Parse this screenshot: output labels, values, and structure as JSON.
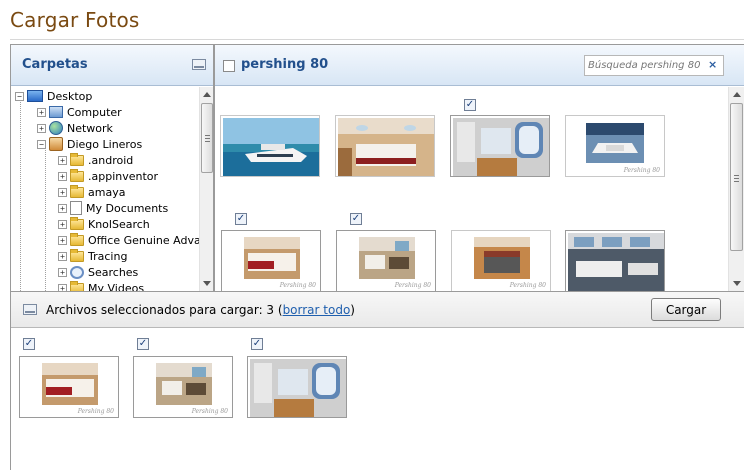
{
  "page": {
    "title": "Cargar Fotos"
  },
  "folders": {
    "title": "Carpetas",
    "items": [
      {
        "label": "Desktop",
        "icon": "desktop-icon"
      },
      {
        "label": "Computer",
        "icon": "computer-icon"
      },
      {
        "label": "Network",
        "icon": "network-icon"
      },
      {
        "label": "Diego Lineros",
        "icon": "user-folder-icon"
      },
      {
        "label": ".android",
        "icon": "folder-icon"
      },
      {
        "label": ".appinventor",
        "icon": "folder-icon"
      },
      {
        "label": "amaya",
        "icon": "folder-icon"
      },
      {
        "label": "My Documents",
        "icon": "documents-icon"
      },
      {
        "label": "KnolSearch",
        "icon": "folder-icon"
      },
      {
        "label": "Office Genuine Advan",
        "icon": "folder-icon"
      },
      {
        "label": "Tracing",
        "icon": "folder-icon"
      },
      {
        "label": "Searches",
        "icon": "search-folder-icon"
      },
      {
        "label": "My Videos",
        "icon": "folder-icon"
      }
    ]
  },
  "album": {
    "title": "pershing 80",
    "search_placeholder": "Búsqueda pershing 80",
    "clear_symbol": "×",
    "photo_caption": "Pershing 80",
    "photos": [
      {
        "kind": "exterior",
        "checked": false
      },
      {
        "kind": "cabin",
        "checked": false
      },
      {
        "kind": "bathroom",
        "checked": true
      },
      {
        "kind": "deck",
        "checked": false
      },
      {
        "kind": "bed",
        "checked": true
      },
      {
        "kind": "lounge",
        "checked": true
      },
      {
        "kind": "bed-dark",
        "checked": false
      },
      {
        "kind": "salon",
        "checked": false
      }
    ]
  },
  "selection": {
    "prefix": "Archivos seleccionados para cargar: 3 (",
    "clear_label": "borrar todo",
    "suffix": ")",
    "upload_label": "Cargar",
    "check_mark": "✓"
  },
  "colors": {
    "title": "#7a4a12",
    "header_text": "#22508c",
    "link": "#1f5fae"
  }
}
